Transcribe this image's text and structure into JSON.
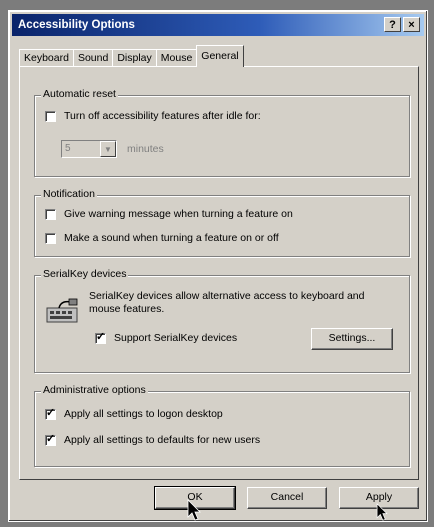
{
  "window": {
    "title": "Accessibility Options",
    "help_button": "?",
    "close_button": "×"
  },
  "tabs": [
    {
      "label": "Keyboard"
    },
    {
      "label": "Sound"
    },
    {
      "label": "Display"
    },
    {
      "label": "Mouse"
    },
    {
      "label": "General",
      "active": true
    }
  ],
  "automatic_reset": {
    "label": "Automatic reset",
    "checkbox_label": "Turn off accessibility features after idle for:",
    "checked": false,
    "minutes_value": "5",
    "minutes_label": "minutes"
  },
  "notification": {
    "label": "Notification",
    "warning_label": "Give warning message when turning a feature on",
    "warning_checked": false,
    "sound_label": "Make a sound when turning a feature on or off",
    "sound_checked": false
  },
  "serialkey": {
    "label": "SerialKey devices",
    "description": "SerialKey devices allow alternative access to keyboard and mouse features.",
    "support_label": "Support SerialKey devices",
    "support_checked": true,
    "settings_button": "Settings..."
  },
  "admin": {
    "label": "Administrative options",
    "logon_label": "Apply all settings to logon desktop",
    "logon_checked": true,
    "defaults_label": "Apply all settings to defaults for new users",
    "defaults_checked": true
  },
  "buttons": {
    "ok": "OK",
    "cancel": "Cancel",
    "apply": "Apply"
  },
  "colors": {
    "titlebar": "#0a246a",
    "face": "#d4d0c8"
  }
}
